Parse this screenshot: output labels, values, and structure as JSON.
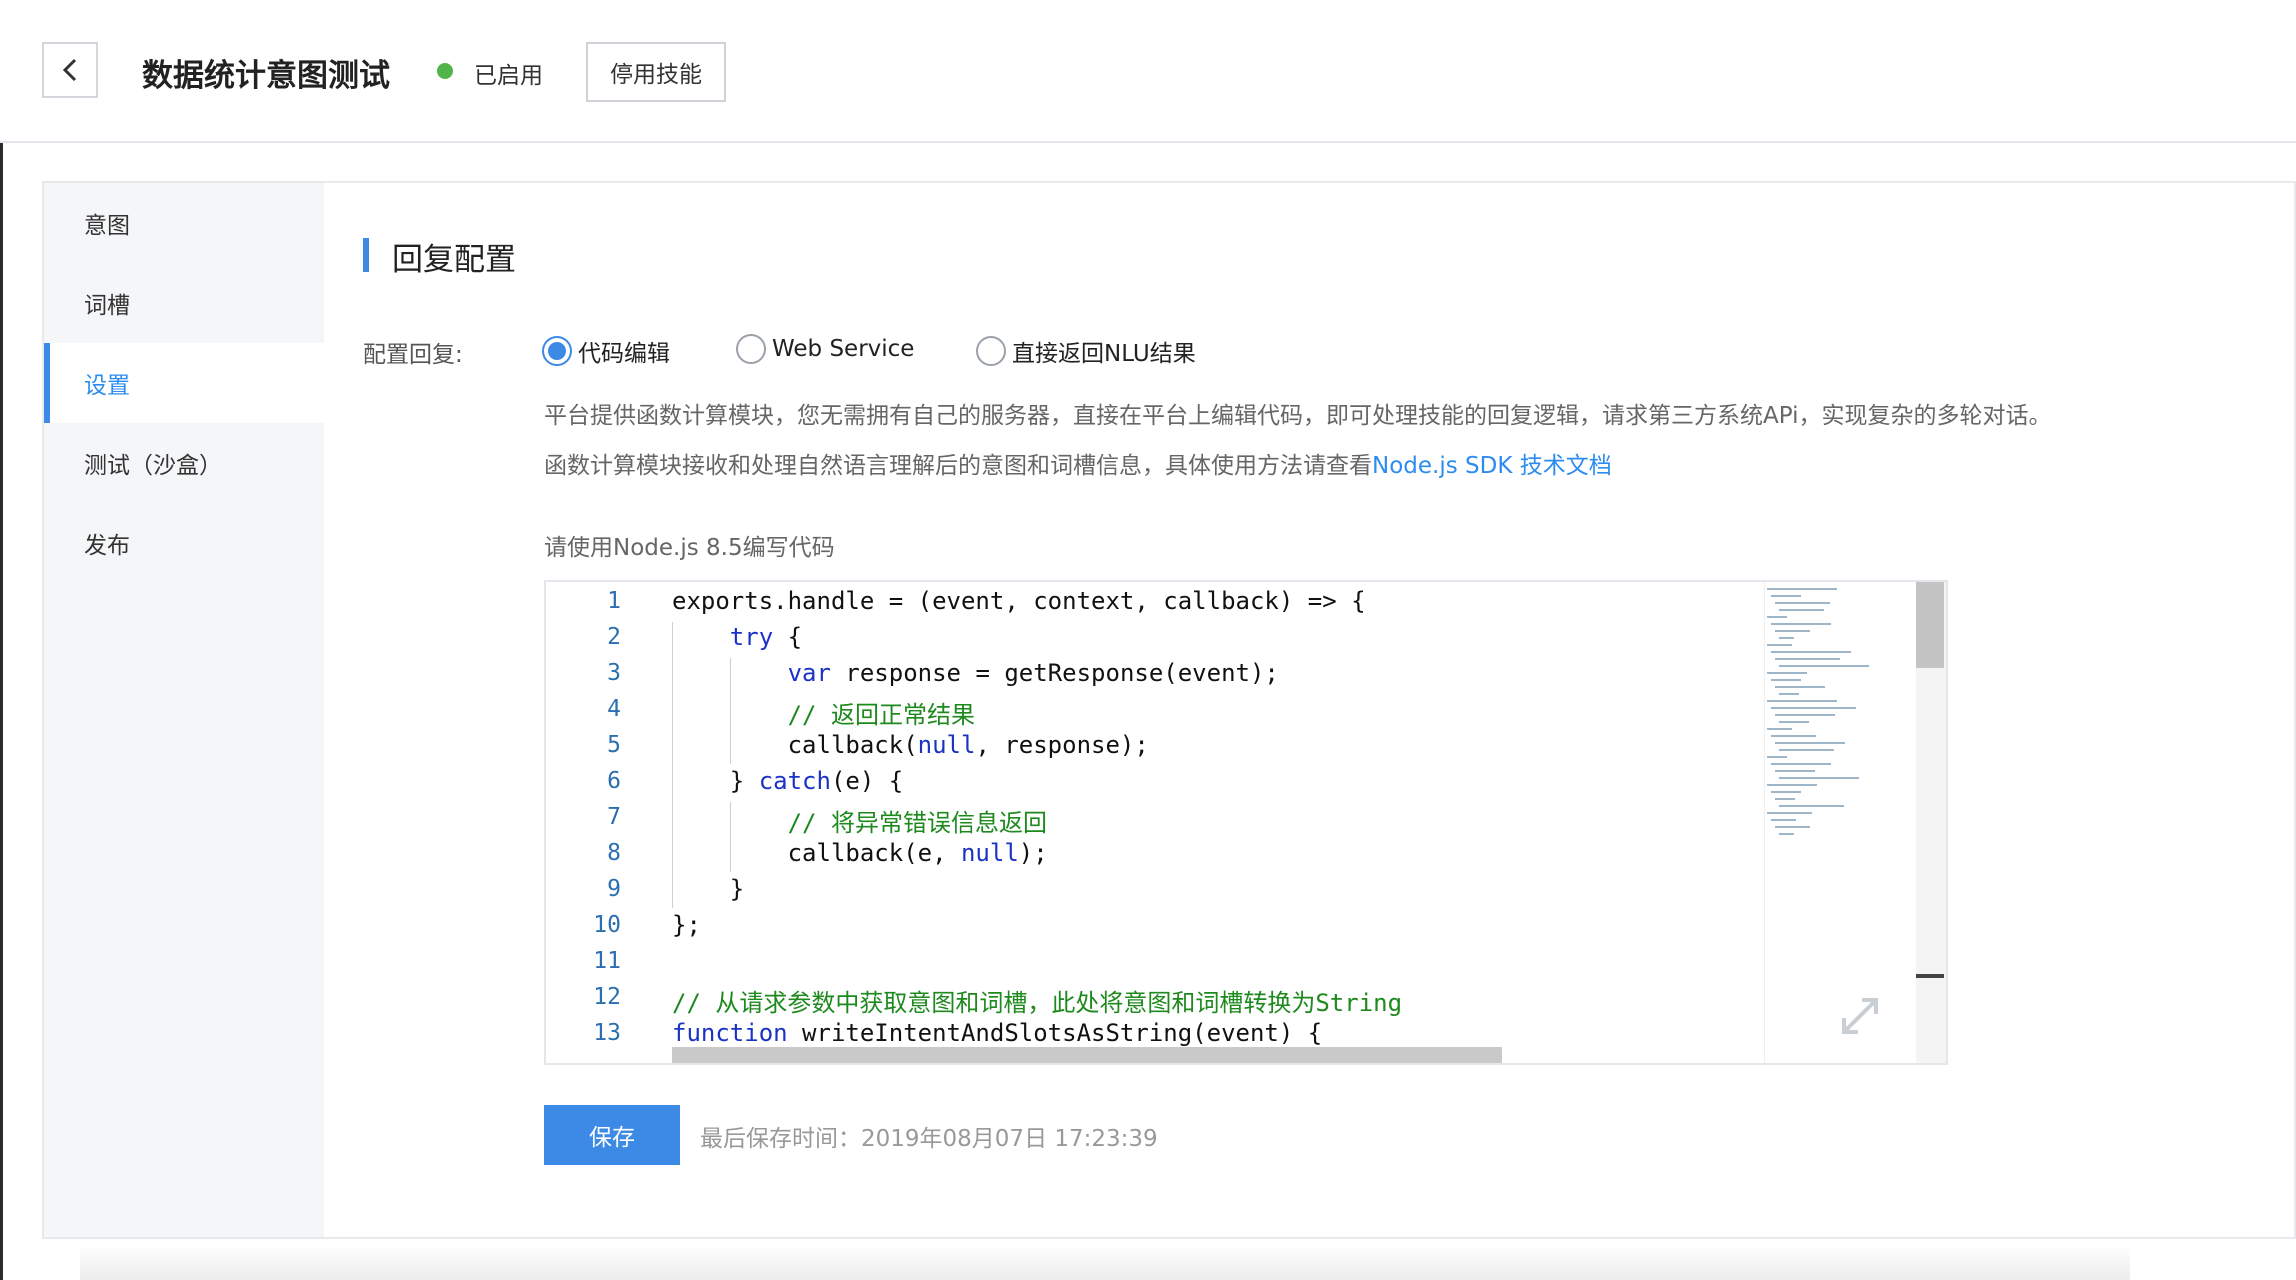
{
  "header": {
    "title": "数据统计意图测试",
    "status": "已启用",
    "status_color": "#52b34a",
    "disable_button": "停用技能",
    "back_icon": "chevron-left-icon"
  },
  "sidebar": {
    "items": [
      {
        "label": "意图",
        "active": false
      },
      {
        "label": "词槽",
        "active": false
      },
      {
        "label": "设置",
        "active": true
      },
      {
        "label": "测试（沙盒）",
        "active": false
      },
      {
        "label": "发布",
        "active": false
      }
    ]
  },
  "main": {
    "section_title": "回复配置",
    "config_label": "配置回复:",
    "options": [
      {
        "label": "代码编辑",
        "checked": true
      },
      {
        "label": "Web Service",
        "checked": false
      },
      {
        "label": "直接返回NLU结果",
        "checked": false
      }
    ],
    "desc_line1": "平台提供函数计算模块，您无需拥有自己的服务器，直接在平台上编辑代码，即可处理技能的回复逻辑，请求第三方系统APi，实现复杂的多轮对话。",
    "desc_line2_prefix": "函数计算模块接收和处理自然语言理解后的意图和词槽信息，具体使用方法请查看",
    "desc_link": "Node.js SDK 技术文档",
    "node_note": "请使用Node.js 8.5编写代码",
    "accent_color": "#3d8ae6"
  },
  "editor": {
    "line_numbers": [
      "1",
      "2",
      "3",
      "4",
      "5",
      "6",
      "7",
      "8",
      "9",
      "10",
      "11",
      "12",
      "13"
    ],
    "code_lines": [
      "exports.handle = (event, context, callback) => {",
      "    try {",
      "        var response = getResponse(event);",
      "        // 返回正常结果",
      "        callback(null, response);",
      "    } catch(e) {",
      "        // 将异常错误信息返回",
      "        callback(e, null);",
      "    }",
      "};",
      "",
      "// 从请求参数中获取意图和词槽，此处将意图和词槽转换为String",
      "function writeIntentAndSlotsAsString(event) {"
    ],
    "expand_icon": "expand-icon"
  },
  "footer": {
    "save_button": "保存",
    "last_saved": "最后保存时间：2019年08月07日 17:23:39"
  }
}
